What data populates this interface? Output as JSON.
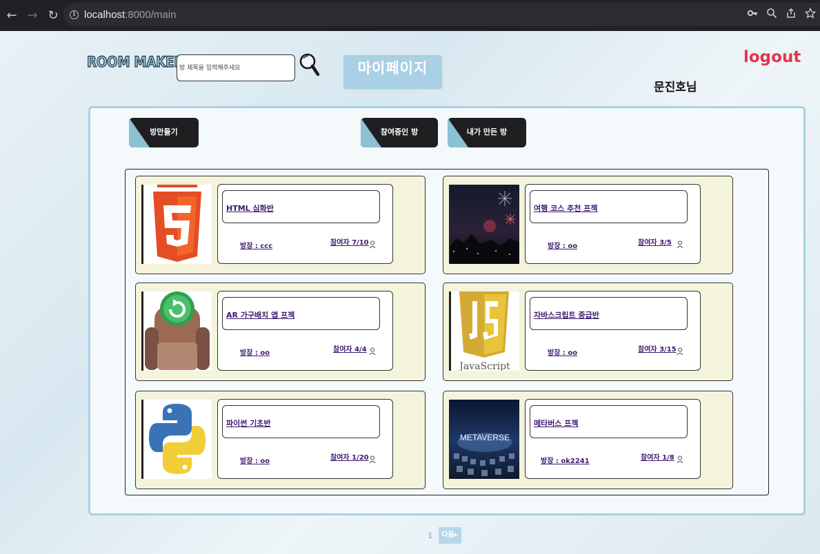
{
  "browser": {
    "url_host": "localhost",
    "url_path": ":8000/main"
  },
  "header": {
    "logo": "ROOM MAKER",
    "search_placeholder": "방 제목을 입력해주세요",
    "mypage_label": "마이페이지",
    "logout_label": "logout",
    "username": "문진호님"
  },
  "actions": {
    "create_room": "방만들기",
    "joined_rooms": "참여중인 방",
    "my_rooms": "내가 만든 방"
  },
  "rooms": [
    {
      "title": "HTML 심화반",
      "leader": "방장 : ccc",
      "members": "참여자 7/10",
      "thumb": "html5-logo"
    },
    {
      "title": "여행 코스 추천 프젝",
      "leader": "방장 : oo",
      "members": "참여자 3/5",
      "thumb": "fireworks-photo"
    },
    {
      "title": "AR 가구배치 앱 프젝",
      "leader": "방장 : oo",
      "members": "참여자 4/4",
      "thumb": "armchair-icon"
    },
    {
      "title": "자바스크립트 중급반",
      "leader": "방장 : oo",
      "members": "참여자 3/15",
      "thumb": "javascript-logo"
    },
    {
      "title": "파이썬 기초반",
      "leader": "방장 : oo",
      "members": "참여자 1/20",
      "thumb": "python-logo"
    },
    {
      "title": "메타버스 프젝",
      "leader": "방장 : ok2241",
      "members": "참여자 1/8",
      "thumb": "metaverse-photo"
    }
  ],
  "thumb_text": {
    "js": "JavaScript",
    "metaverse": "METAVERSE"
  },
  "pagination": {
    "current": "1",
    "next_label": "다음"
  },
  "colors": {
    "accent": "#a9d0e4",
    "logout": "#e0354a",
    "card_bg": "#f4f3dc",
    "link": "#3d1a6e"
  }
}
